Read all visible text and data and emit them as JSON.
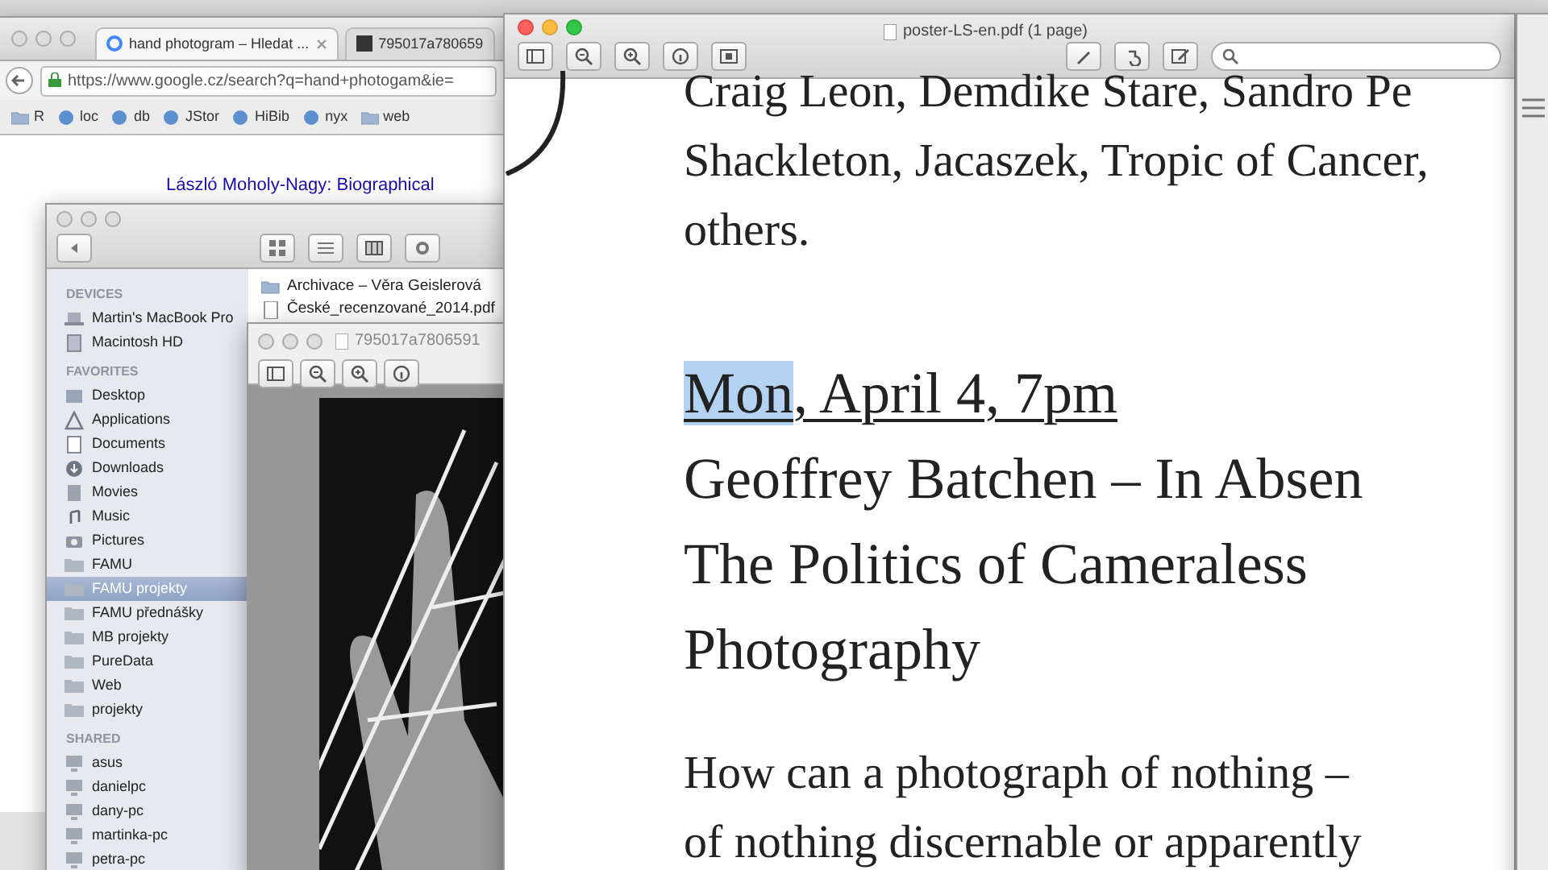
{
  "browser": {
    "tabs": [
      {
        "label": "hand photogram – Hledat ...",
        "selected": true
      },
      {
        "label": "795017a780659",
        "selected": false
      }
    ],
    "url": "https://www.google.cz/search?q=hand+photogam&ie=",
    "bookmarks": [
      {
        "label": "R",
        "kind": "folder"
      },
      {
        "label": "loc",
        "kind": "site"
      },
      {
        "label": "db",
        "kind": "site"
      },
      {
        "label": "JStor",
        "kind": "site"
      },
      {
        "label": "HiBib",
        "kind": "site"
      },
      {
        "label": "nyx",
        "kind": "site"
      },
      {
        "label": "web",
        "kind": "folder"
      }
    ],
    "result_title": "László Moholy-Nagy: Biographical"
  },
  "finder": {
    "sections": [
      {
        "title": "DEVICES",
        "items": [
          {
            "label": "Martin's MacBook Pro",
            "kind": "laptop",
            "selected": false
          },
          {
            "label": "Macintosh HD",
            "kind": "disk",
            "selected": false
          }
        ]
      },
      {
        "title": "FAVORITES",
        "items": [
          {
            "label": "Desktop",
            "kind": "desktop",
            "selected": false
          },
          {
            "label": "Applications",
            "kind": "apps",
            "selected": false
          },
          {
            "label": "Documents",
            "kind": "doc",
            "selected": false
          },
          {
            "label": "Downloads",
            "kind": "download",
            "selected": false
          },
          {
            "label": "Movies",
            "kind": "film",
            "selected": false
          },
          {
            "label": "Music",
            "kind": "music",
            "selected": false
          },
          {
            "label": "Pictures",
            "kind": "camera",
            "selected": false
          },
          {
            "label": "FAMU",
            "kind": "folder",
            "selected": false
          },
          {
            "label": "FAMU projekty",
            "kind": "folder",
            "selected": true
          },
          {
            "label": "FAMU přednášky",
            "kind": "folder",
            "selected": false
          },
          {
            "label": "MB projekty",
            "kind": "folder",
            "selected": false
          },
          {
            "label": "PureData",
            "kind": "folder",
            "selected": false
          },
          {
            "label": "Web",
            "kind": "folder",
            "selected": false
          },
          {
            "label": "projekty",
            "kind": "folder",
            "selected": false
          }
        ]
      },
      {
        "title": "SHARED",
        "items": [
          {
            "label": "asus",
            "kind": "computer",
            "selected": false
          },
          {
            "label": "danielpc",
            "kind": "computer",
            "selected": false
          },
          {
            "label": "dany-pc",
            "kind": "computer",
            "selected": false
          },
          {
            "label": "martinka-pc",
            "kind": "computer",
            "selected": false
          },
          {
            "label": "petra-pc",
            "kind": "computer",
            "selected": false
          }
        ]
      }
    ],
    "files": [
      {
        "name": "Archivace – Věra Geislerová",
        "kind": "folder"
      },
      {
        "name": "České_recenzované_2014.pdf",
        "kind": "pdf"
      }
    ]
  },
  "image_window": {
    "title": "795017a7806591"
  },
  "pdf_window": {
    "title": "poster-LS-en.pdf (1 page)",
    "lines": [
      {
        "kind": "body",
        "text": "Craig Leon, Demdike Stare, Sandro Pe"
      },
      {
        "kind": "body",
        "text": "Shackleton, Jacaszek, Tropic of Cancer,"
      },
      {
        "kind": "body",
        "text": "others."
      },
      {
        "kind": "gap"
      },
      {
        "kind": "date",
        "parts": [
          {
            "text": "Mon",
            "selected": true
          },
          {
            "text": ", April 4, 7pm",
            "selected": false
          }
        ]
      },
      {
        "kind": "title",
        "text": "Geoffrey Batchen – In Absen"
      },
      {
        "kind": "title",
        "text": "The Politics of Cameraless"
      },
      {
        "kind": "title",
        "text": "Photography"
      },
      {
        "kind": "gap"
      },
      {
        "kind": "body",
        "text": "How can a photograph of nothing –"
      },
      {
        "kind": "body",
        "text": "of nothing discernable or apparently"
      }
    ]
  }
}
